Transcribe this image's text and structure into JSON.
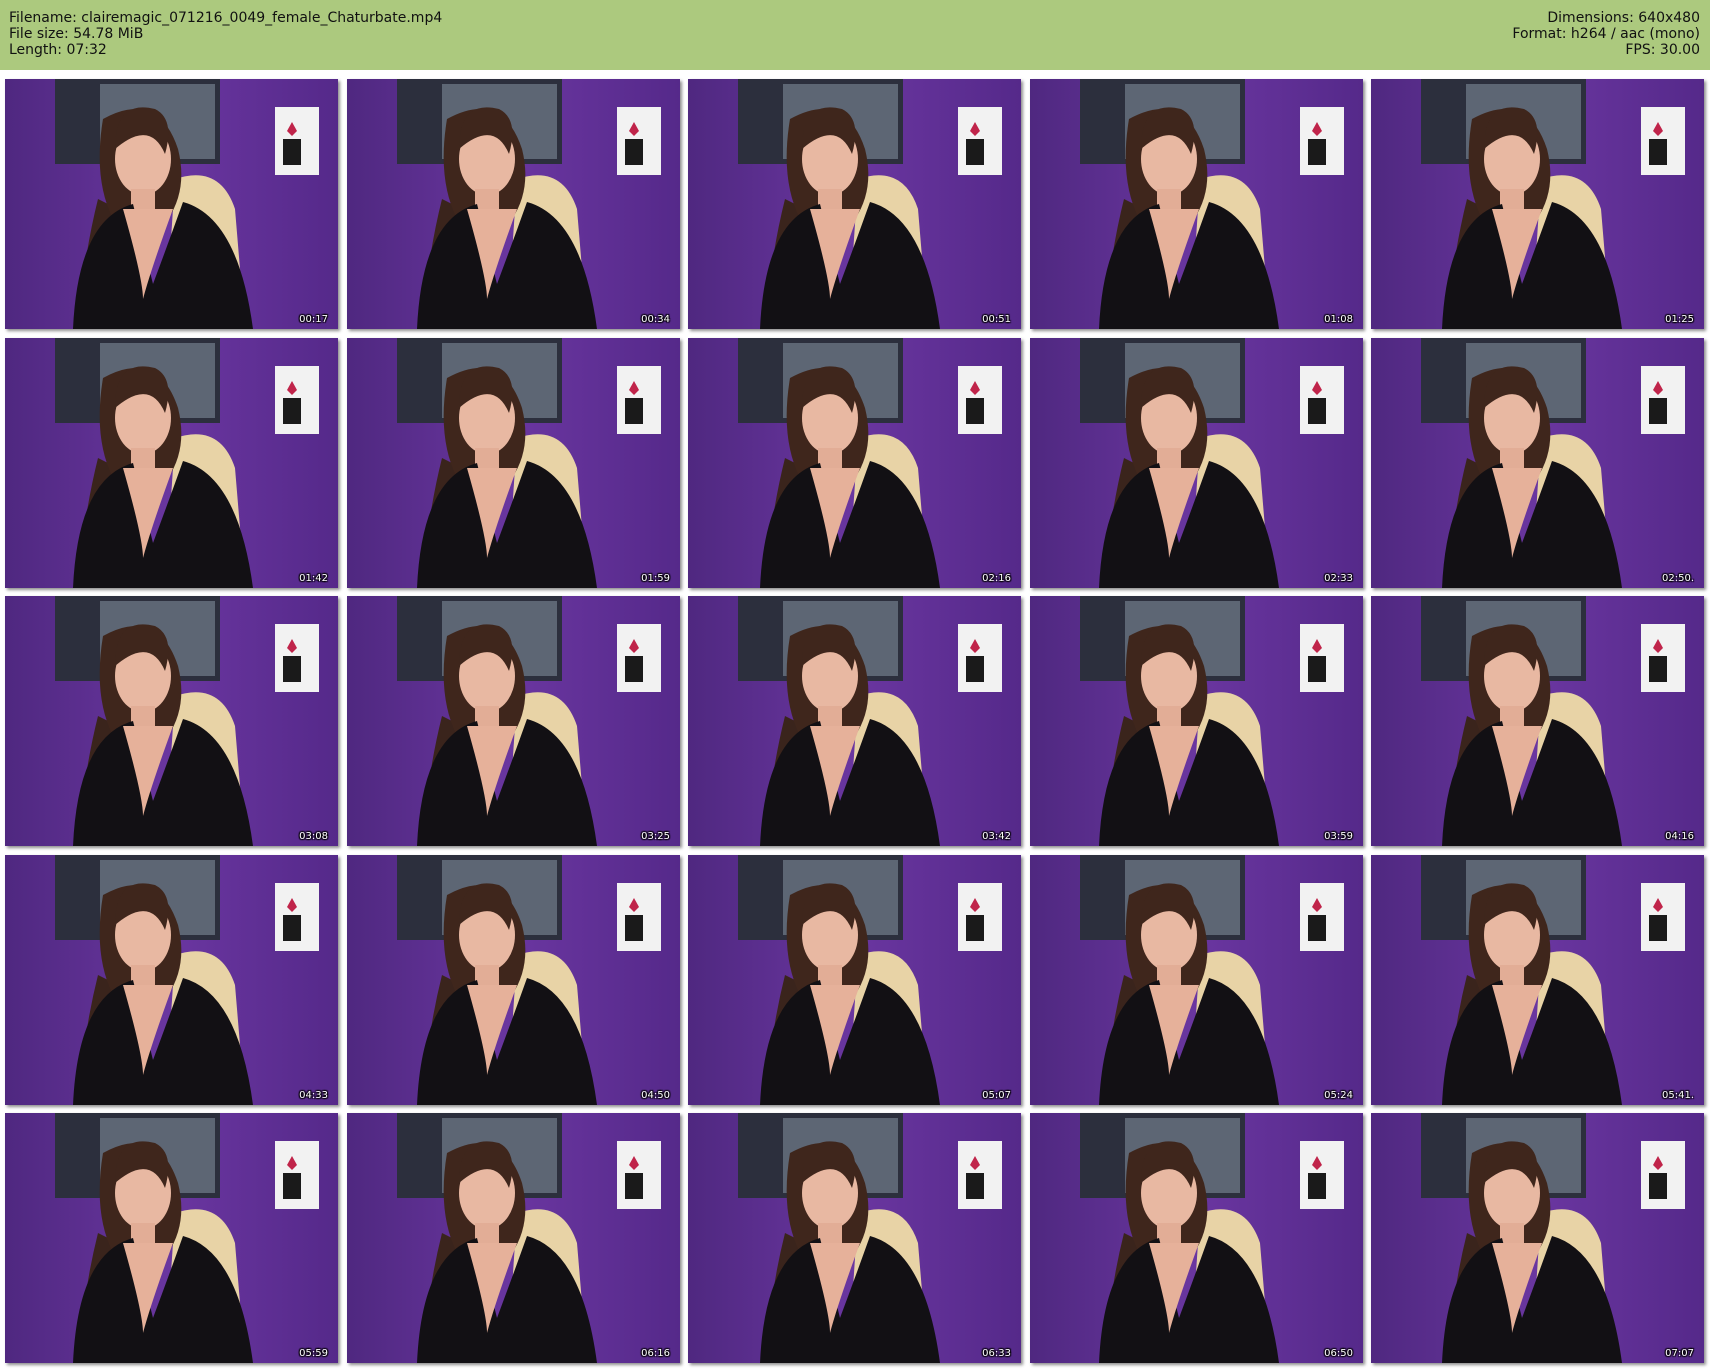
{
  "header": {
    "filename": "Filename: clairemagic_071216_0049_female_Chaturbate.mp4",
    "filesize": "File size: 54.78 MiB",
    "length": "Length: 07:32",
    "dimensions": "Dimensions: 640x480",
    "format": "Format: h264 / aac (mono)",
    "fps": "FPS: 30.00"
  },
  "colors": {
    "header_bg": "#acc97e",
    "wall": "#5d2f8c"
  },
  "thumbnails": [
    {
      "timestamp": "00:17"
    },
    {
      "timestamp": "00:34"
    },
    {
      "timestamp": "00:51"
    },
    {
      "timestamp": "01:08"
    },
    {
      "timestamp": "01:25"
    },
    {
      "timestamp": "01:42"
    },
    {
      "timestamp": "01:59"
    },
    {
      "timestamp": "02:16"
    },
    {
      "timestamp": "02:33"
    },
    {
      "timestamp": "02:50."
    },
    {
      "timestamp": "03:08"
    },
    {
      "timestamp": "03:25"
    },
    {
      "timestamp": "03:42"
    },
    {
      "timestamp": "03:59"
    },
    {
      "timestamp": "04:16"
    },
    {
      "timestamp": "04:33"
    },
    {
      "timestamp": "04:50"
    },
    {
      "timestamp": "05:07"
    },
    {
      "timestamp": "05:24"
    },
    {
      "timestamp": "05:41."
    },
    {
      "timestamp": "05:59"
    },
    {
      "timestamp": "06:16"
    },
    {
      "timestamp": "06:33"
    },
    {
      "timestamp": "06:50"
    },
    {
      "timestamp": "07:07"
    }
  ]
}
